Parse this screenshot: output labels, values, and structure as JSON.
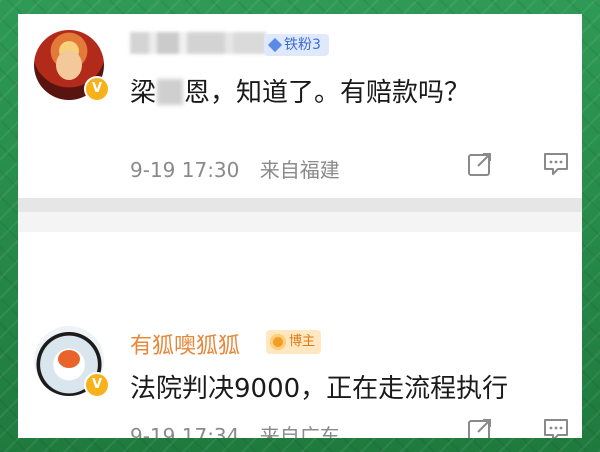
{
  "colors": {
    "accent_orange": "#e8873a",
    "fan_blue": "#3d6ccf",
    "meta_gray": "#8a8a8a",
    "frame_green": "#2f8a4c"
  },
  "comments": [
    {
      "username_obscured": true,
      "badge": {
        "icon": "diamond-icon",
        "label": "铁粉3"
      },
      "text_before": "梁",
      "text_after": "恩，知道了。有赔款吗？",
      "time": "9-19 17:30",
      "location": "来自福建",
      "actions": [
        {
          "icon": "share-icon"
        },
        {
          "icon": "comment-icon"
        }
      ]
    },
    {
      "username": "有狐噢狐狐",
      "badge": {
        "icon": "medal-icon",
        "label": "博主"
      },
      "text": "法院判决9000，正在走流程执行",
      "time": "9-19 17:34",
      "location": "来自广东",
      "actions": [
        {
          "icon": "share-icon"
        },
        {
          "icon": "comment-icon"
        }
      ]
    }
  ]
}
